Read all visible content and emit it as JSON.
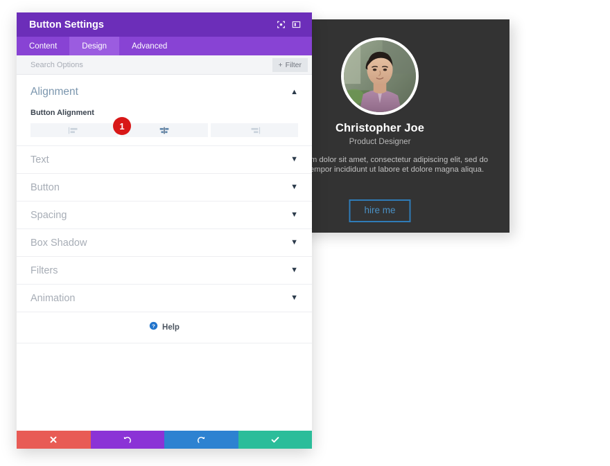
{
  "panel": {
    "title": "Button Settings",
    "header_icons": [
      {
        "name": "target-icon"
      },
      {
        "name": "panel-layout-icon"
      }
    ],
    "tabs": [
      {
        "label": "Content",
        "active": false
      },
      {
        "label": "Design",
        "active": true
      },
      {
        "label": "Advanced",
        "active": false
      }
    ],
    "search": {
      "placeholder": "Search Options",
      "value": ""
    },
    "filter_button": {
      "label": "Filter",
      "icon": "plus-icon"
    },
    "alignment_section": {
      "title": "Alignment",
      "field_label": "Button Alignment",
      "options": [
        {
          "name": "align-left",
          "active": false
        },
        {
          "name": "align-center",
          "active": true
        },
        {
          "name": "align-right",
          "active": false
        }
      ],
      "badge": "1"
    },
    "sections": [
      {
        "label": "Text"
      },
      {
        "label": "Button"
      },
      {
        "label": "Spacing"
      },
      {
        "label": "Box Shadow"
      },
      {
        "label": "Filters"
      },
      {
        "label": "Animation"
      }
    ],
    "help": {
      "label": "Help",
      "icon": "question-circle-icon"
    },
    "footer_buttons": [
      {
        "name": "cancel-button",
        "icon": "close-icon",
        "color": "#e85b55"
      },
      {
        "name": "undo-button",
        "icon": "undo-icon",
        "color": "#8b33d6"
      },
      {
        "name": "redo-button",
        "icon": "redo-icon",
        "color": "#2d82d1"
      },
      {
        "name": "save-button",
        "icon": "check-icon",
        "color": "#2bbd9a"
      }
    ]
  },
  "profile_card": {
    "name": "Christopher Joe",
    "role": "Product Designer",
    "description": "Lorem ipsum dolor sit amet, consectetur adipiscing elit, sed do eiusmod tempor incididunt ut labore et dolore magna aliqua.",
    "button_label": "hire me",
    "avatar_alt": "portrait-photo",
    "colors": {
      "card_background": "#333333",
      "button_border": "#2f7cb8",
      "button_text": "#4a90c4"
    }
  },
  "colors": {
    "header_purple": "#6c2eb9",
    "tabs_purple": "#8843d4",
    "tab_active_purple": "#9b5ce0",
    "badge_red": "#d81818",
    "section_title": "#7b96ae"
  }
}
